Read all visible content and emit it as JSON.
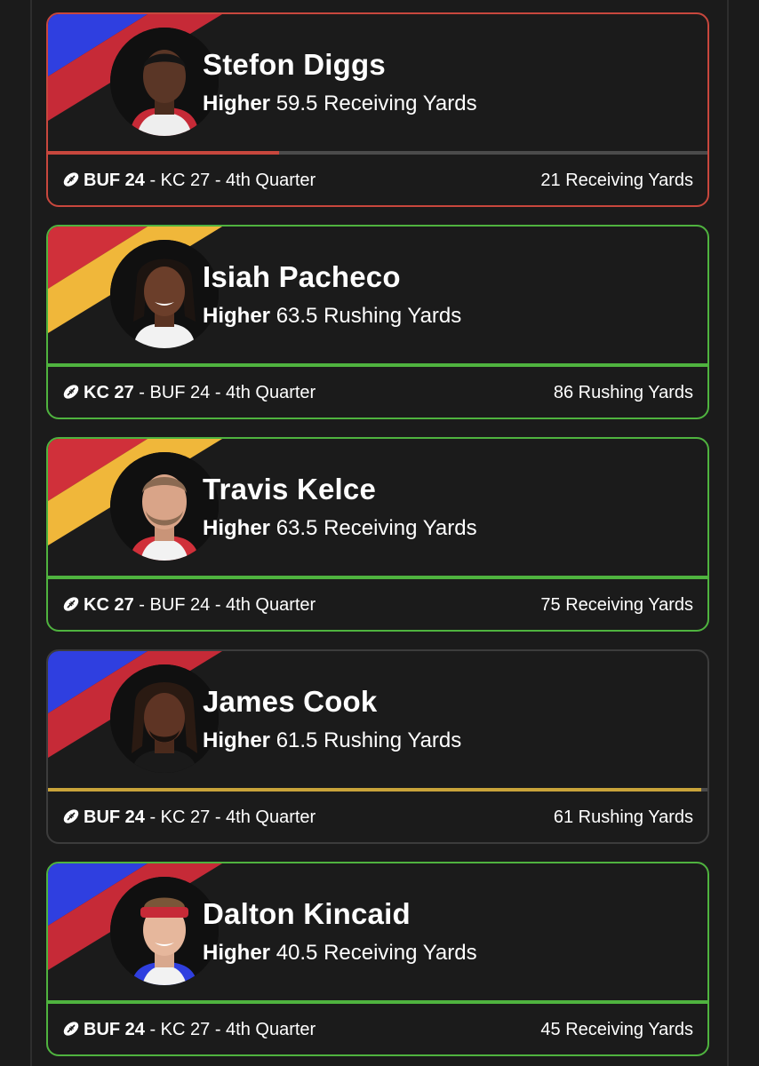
{
  "colors": {
    "miss": "#c8473d",
    "hit": "#4fb33f",
    "push": "#3c3c3c",
    "track": "#4b4b4b",
    "gold": "#c9a43a",
    "buf_blue": "#2f3fe0",
    "buf_red": "#c62a37",
    "kc_red": "#d0303a",
    "kc_gold": "#f0b73a"
  },
  "cards": [
    {
      "status": "miss",
      "team_colors": [
        "#2f3fe0",
        "#c62a37"
      ],
      "player": "Stefon Diggs",
      "direction": "Higher",
      "line": "59.5 Receiving Yards",
      "progress": 0.35,
      "progress_color": "#c8473d",
      "team": "BUF 24",
      "rest": " - KC 27 - 4th Quarter",
      "result": "21 Receiving Yards"
    },
    {
      "status": "hit",
      "team_colors": [
        "#d0303a",
        "#f0b73a"
      ],
      "player": "Isiah Pacheco",
      "direction": "Higher",
      "line": "63.5 Rushing Yards",
      "progress": 1.0,
      "progress_color": "#4fb33f",
      "team": "KC 27",
      "rest": " - BUF 24 - 4th Quarter",
      "result": "86 Rushing Yards"
    },
    {
      "status": "hit",
      "team_colors": [
        "#d0303a",
        "#f0b73a"
      ],
      "player": "Travis Kelce",
      "direction": "Higher",
      "line": "63.5 Receiving Yards",
      "progress": 1.0,
      "progress_color": "#4fb33f",
      "team": "KC 27",
      "rest": " - BUF 24 - 4th Quarter",
      "result": "75 Receiving Yards"
    },
    {
      "status": "push",
      "team_colors": [
        "#2f3fe0",
        "#c62a37"
      ],
      "player": "James Cook",
      "direction": "Higher",
      "line": "61.5 Rushing Yards",
      "progress": 0.99,
      "progress_color": "#c9a43a",
      "team": "BUF 24",
      "rest": " - KC 27 - 4th Quarter",
      "result": "61 Rushing Yards"
    },
    {
      "status": "hit",
      "team_colors": [
        "#2f3fe0",
        "#c62a37"
      ],
      "player": "Dalton Kincaid",
      "direction": "Higher",
      "line": "40.5 Receiving Yards",
      "progress": 1.0,
      "progress_color": "#4fb33f",
      "team": "BUF 24",
      "rest": " - KC 27 - 4th Quarter",
      "result": "45 Receiving Yards"
    }
  ]
}
